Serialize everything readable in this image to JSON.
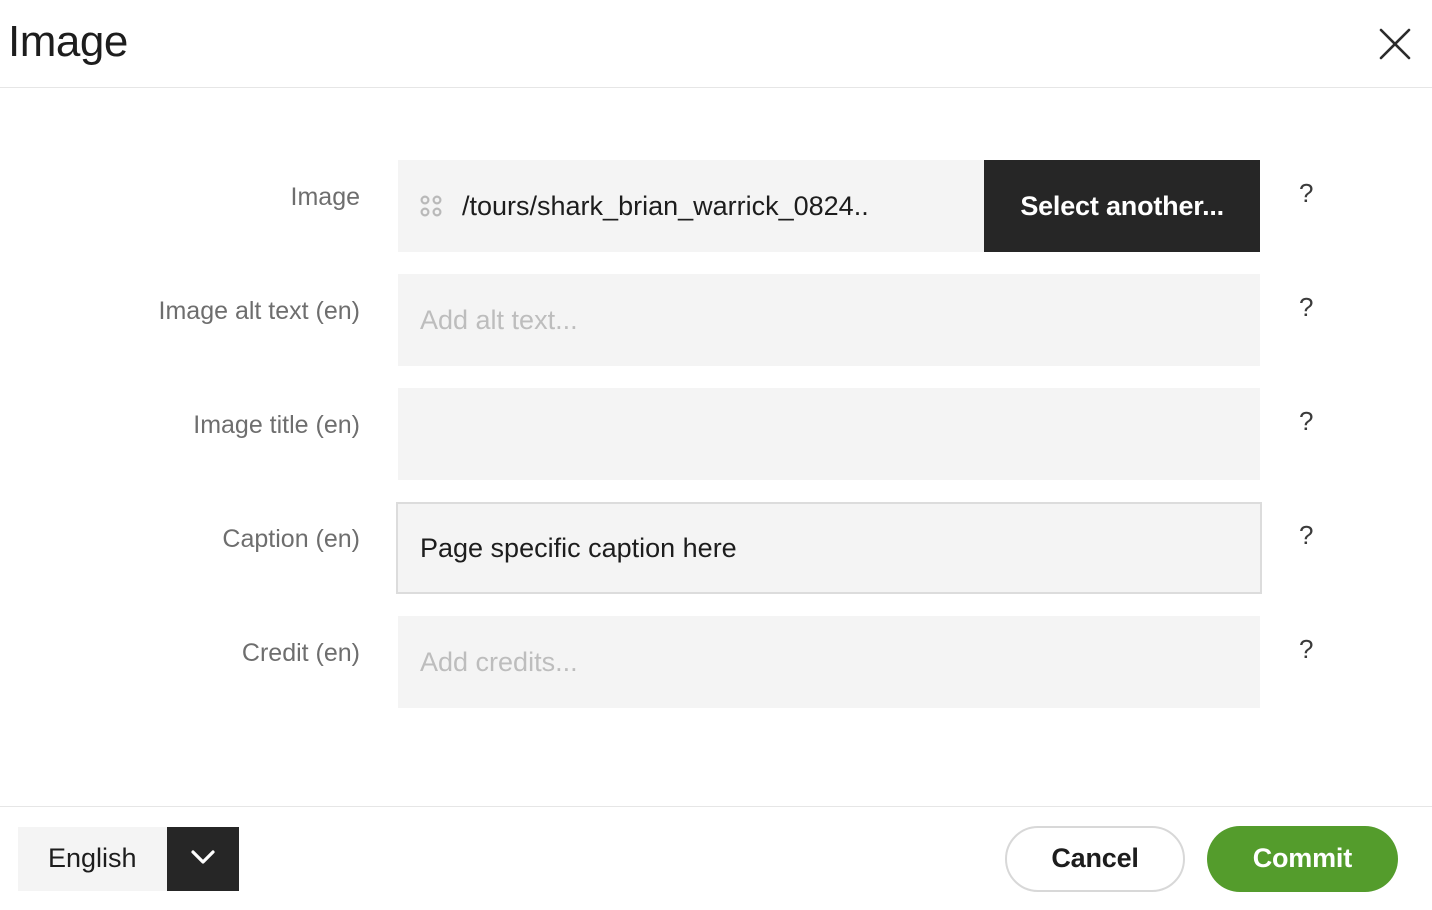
{
  "header": {
    "title": "Image",
    "close_icon": "close-icon"
  },
  "fields": [
    {
      "label": "Image",
      "type": "image-picker",
      "drag_handle_icon": "grid-dots-icon",
      "value": "/tours/shark_brian_warrick_0824..",
      "button_label": "Select another...",
      "help": "?"
    },
    {
      "label": "Image alt text (en)",
      "type": "text",
      "value": "",
      "placeholder": "Add alt text...",
      "help": "?"
    },
    {
      "label": "Image title (en)",
      "type": "text",
      "value": "",
      "placeholder": "",
      "help": "?"
    },
    {
      "label": "Caption (en)",
      "type": "text",
      "value": "Page specific caption here",
      "placeholder": "",
      "help": "?"
    },
    {
      "label": "Credit (en)",
      "type": "text",
      "value": "",
      "placeholder": "Add credits...",
      "help": "?"
    }
  ],
  "footer": {
    "language": {
      "selected": "English",
      "chevron_icon": "chevron-down-icon"
    },
    "cancel_label": "Cancel",
    "commit_label": "Commit"
  },
  "colors": {
    "accent_commit": "#549c2c",
    "dark_button": "#262626",
    "field_background": "#f4f4f4",
    "label_text": "#6e6e6e",
    "placeholder_text": "#bdbdbd"
  }
}
